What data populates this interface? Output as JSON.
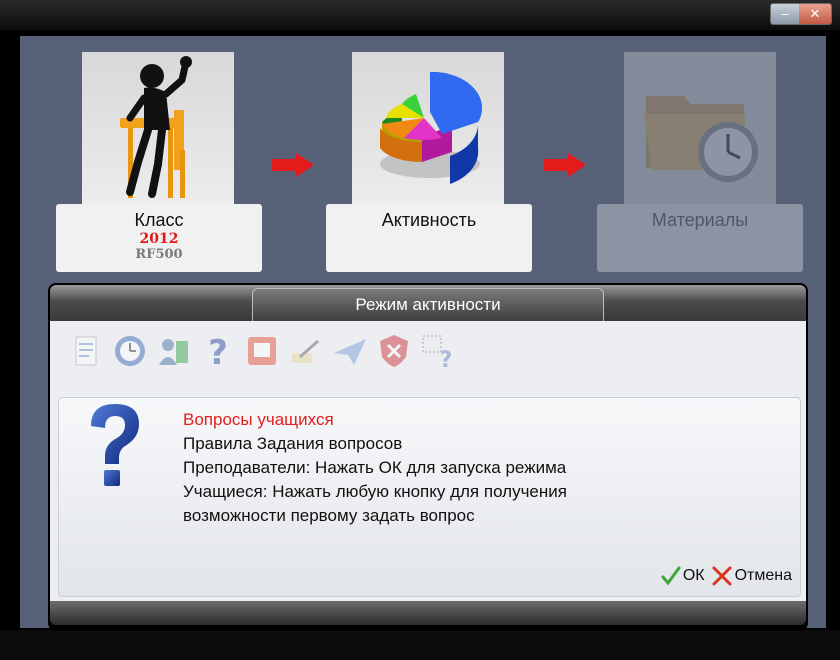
{
  "window": {
    "minimize_symbol": "‒",
    "close_symbol": "✕"
  },
  "steps": [
    {
      "title": "Класс",
      "year": "2012",
      "model": "RF500",
      "icon": "student-at-desk-icon"
    },
    {
      "title": "Активность",
      "icon": "pie-chart-icon"
    },
    {
      "title": "Материалы",
      "icon": "folder-clock-icon"
    }
  ],
  "dialog": {
    "title": "Режим активности",
    "toolbar_icons": [
      "document-icon",
      "clock-icon",
      "user-book-icon",
      "question-icon",
      "presentation-icon",
      "pen-icon",
      "paper-plane-icon",
      "shield-x-icon",
      "select-question-icon"
    ],
    "message": {
      "heading": "Вопросы учащихся",
      "lines": [
        "Правила Задания вопросов",
        "Преподаватели: Нажать ОК для запуска режима",
        "Учащиеся: Нажать любую кнопку для получения",
        "возможности первому задать вопрос"
      ]
    },
    "ok_label": "ОК",
    "cancel_label": "Отмена"
  },
  "colors": {
    "background": "#576178",
    "accent_red": "#e02020",
    "ok_green": "#3aa63a",
    "cancel_red": "#d9341c"
  }
}
